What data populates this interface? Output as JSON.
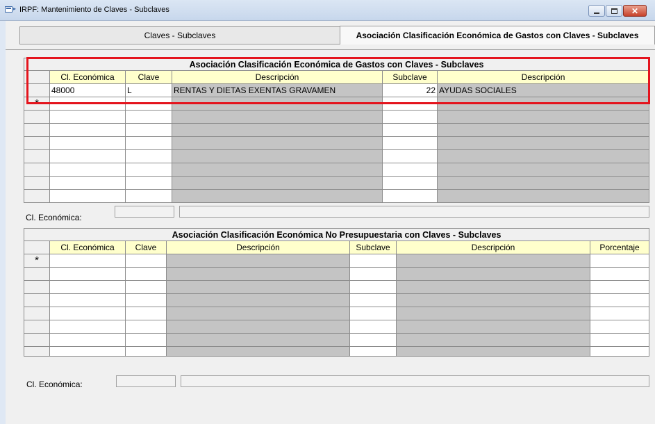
{
  "window": {
    "title": "IRPF: Mantenimiento de Claves - Subclaves"
  },
  "tabs": [
    {
      "label": "Claves - Subclaves"
    },
    {
      "label": "Asociación Clasificación Económica de Gastos con Claves - Subclaves"
    }
  ],
  "grid1": {
    "caption": "Asociación Clasificación Económica de Gastos con Claves - Subclaves",
    "headers": [
      "Cl. Económica",
      "Clave",
      "Descripción",
      "Subclave",
      "Descripción"
    ],
    "rows": [
      {
        "cl_economica": "48000",
        "clave": "L",
        "descripcion": "RENTAS Y DIETAS EXENTAS GRAVAMEN",
        "subclave": "22",
        "descripcion2": "AYUDAS SOCIALES"
      }
    ],
    "new_row_marker": "*"
  },
  "filter1": {
    "label": "Cl. Económica:",
    "code": "",
    "description": ""
  },
  "grid2": {
    "caption": "Asociación Clasificación Económica No Presupuestaria con Claves - Subclaves",
    "headers": [
      "Cl. Económica",
      "Clave",
      "Descripción",
      "Subclave",
      "Descripción",
      "Porcentaje"
    ],
    "new_row_marker": "*"
  },
  "filter2": {
    "label": "Cl. Económica:",
    "code": "",
    "description": ""
  }
}
